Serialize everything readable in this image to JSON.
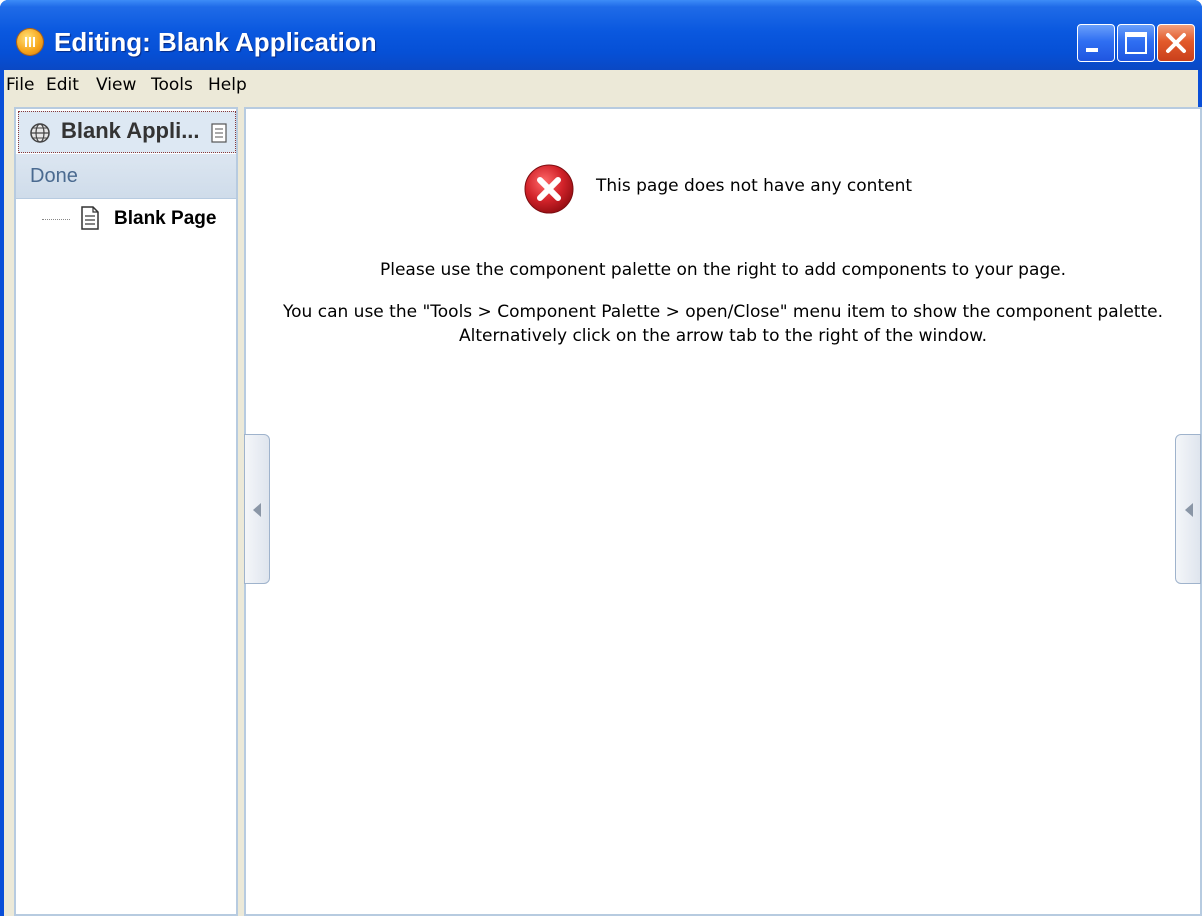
{
  "window": {
    "title": "Editing: Blank Application",
    "app_icon": "application-logo-icon",
    "controls": [
      "minimize-icon",
      "maximize-icon",
      "close-icon"
    ]
  },
  "menu": {
    "items": [
      "File",
      "Edit",
      "View",
      "Tools",
      "Help"
    ]
  },
  "sidebar": {
    "header_title": "Blank Appli...",
    "header_icon": "globe-icon",
    "header_action_icon": "document-icon",
    "done_label": "Done",
    "tree": [
      {
        "label": "Blank Page",
        "icon": "page-icon"
      }
    ]
  },
  "main": {
    "error_icon": "error-icon",
    "error_message": "This page does not have any content",
    "line1": "Please use the component palette on the right to add components to your page.",
    "line2": "You can use the \"Tools > Component Palette > open/Close\" menu item to show the component palette.",
    "line3": "Alternatively click on the arrow tab to the right of the window.",
    "left_tab_icon": "collapse-arrow-icon",
    "right_tab_icon": "expand-palette-arrow-icon"
  },
  "colors": {
    "titlebar": "#0a58df",
    "menubar": "#ece9d8",
    "panel_border": "#b7cbe0",
    "error_red": "#d2232a"
  }
}
